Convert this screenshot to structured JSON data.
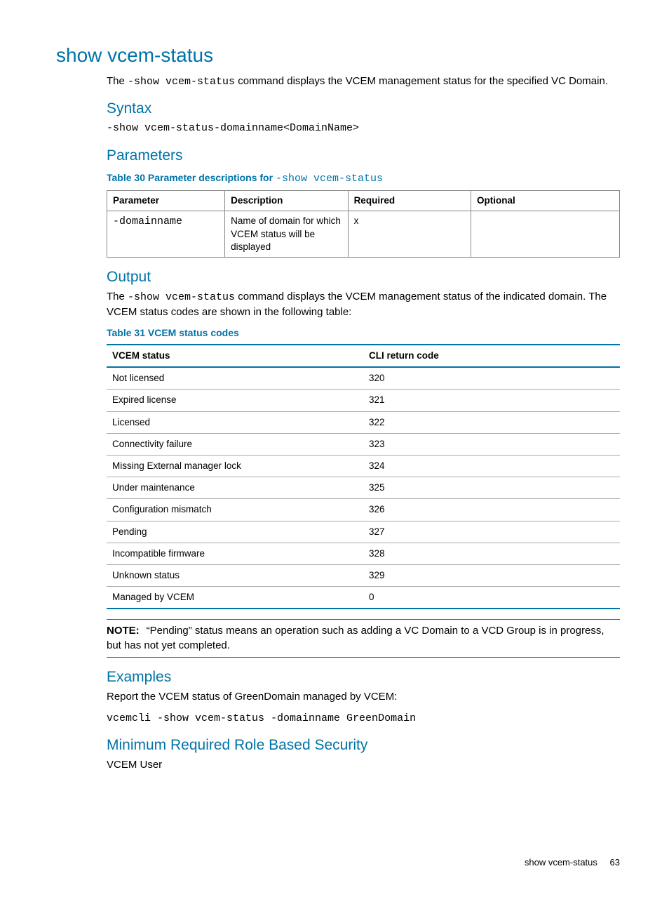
{
  "title": "show vcem-status",
  "intro_pre": "The ",
  "intro_cmd": "-show vcem-status",
  "intro_post": " command displays the VCEM management status for the specified VC Domain.",
  "syntax": {
    "heading": "Syntax",
    "line": "-show vcem-status-domainname<DomainName>"
  },
  "parameters": {
    "heading": "Parameters",
    "caption_pre": "Table 30 Parameter descriptions for ",
    "caption_mono": "-show vcem-status",
    "headers": {
      "p": "Parameter",
      "d": "Description",
      "r": "Required",
      "o": "Optional"
    },
    "rows": [
      {
        "p": "-domainname",
        "d": "Name of domain for which VCEM status will be displayed",
        "r": "x",
        "o": ""
      }
    ]
  },
  "output": {
    "heading": "Output",
    "text_pre": "The ",
    "text_cmd": "-show vcem-status",
    "text_post": " command displays the VCEM management status of the indicated domain. The VCEM status codes are shown in the following table:",
    "caption": "Table 31 VCEM status codes",
    "headers": {
      "s": "VCEM status",
      "c": "CLI return code"
    },
    "rows": [
      {
        "s": "Not licensed",
        "c": "320"
      },
      {
        "s": "Expired license",
        "c": "321"
      },
      {
        "s": "Licensed",
        "c": "322"
      },
      {
        "s": "Connectivity failure",
        "c": "323"
      },
      {
        "s": "Missing External manager lock",
        "c": "324"
      },
      {
        "s": "Under maintenance",
        "c": "325"
      },
      {
        "s": "Configuration mismatch",
        "c": "326"
      },
      {
        "s": "Pending",
        "c": "327"
      },
      {
        "s": "Incompatible firmware",
        "c": "328"
      },
      {
        "s": "Unknown status",
        "c": "329"
      },
      {
        "s": "Managed by VCEM",
        "c": "0"
      }
    ]
  },
  "note": {
    "label": "NOTE:",
    "text": "“Pending” status means an operation such as adding a VC Domain to a VCD Group is in progress, but has not yet completed."
  },
  "examples": {
    "heading": "Examples",
    "text": "Report the VCEM status of GreenDomain managed by VCEM:",
    "cmd": "vcemcli -show vcem-status -domainname GreenDomain"
  },
  "security": {
    "heading": "Minimum Required Role Based Security",
    "text": "VCEM User"
  },
  "footer": {
    "section": "show vcem-status",
    "page": "63"
  }
}
